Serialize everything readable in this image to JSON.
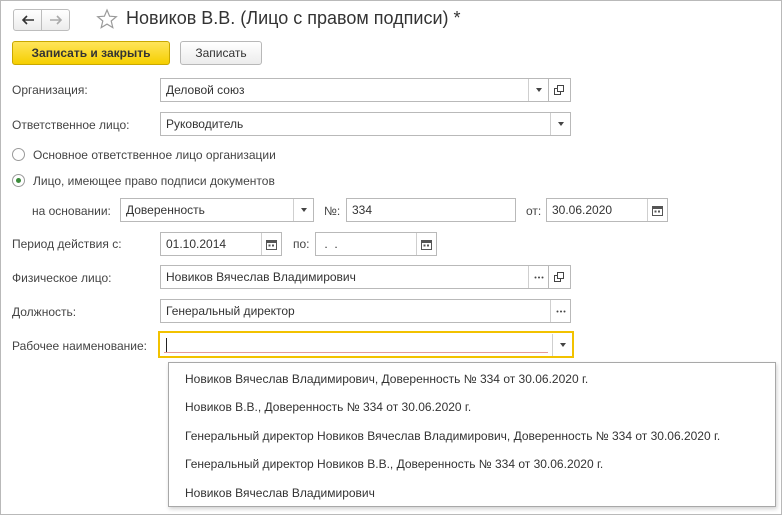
{
  "window": {
    "title": "Новиков В.В. (Лицо с правом подписи) *"
  },
  "toolbar": {
    "save_close_label": "Записать и закрыть",
    "save_label": "Записать"
  },
  "form": {
    "organization": {
      "label": "Организация:",
      "value": "Деловой союз"
    },
    "responsible": {
      "label": "Ответственное лицо:",
      "value": "Руководитель"
    },
    "radio_main": {
      "label": "Основное ответственное лицо организации",
      "selected": false
    },
    "radio_sign": {
      "label": "Лицо, имеющее право подписи документов",
      "selected": true
    },
    "basis": {
      "label": "на основании:",
      "value": "Доверенность",
      "number_label": "№:",
      "number_value": "334",
      "date_label": "от:",
      "date_value": "30.06.2020"
    },
    "period": {
      "label": "Период действия с:",
      "from_value": "01.10.2014",
      "to_label": "по:",
      "to_value": " .  ."
    },
    "person": {
      "label": "Физическое лицо:",
      "value": "Новиков Вячеслав Владимирович"
    },
    "position": {
      "label": "Должность:",
      "value": "Генеральный директор"
    },
    "working_name": {
      "label": "Рабочее наименование:",
      "value": ""
    }
  },
  "dropdown": {
    "items": [
      "Новиков Вячеслав Владимирович, Доверенность № 334 от 30.06.2020 г.",
      "Новиков В.В., Доверенность № 334 от 30.06.2020 г.",
      "Генеральный директор Новиков Вячеслав Владимирович, Доверенность № 334 от 30.06.2020 г.",
      "Генеральный директор Новиков В.В., Доверенность № 334 от 30.06.2020 г.",
      "Новиков Вячеслав Владимирович"
    ]
  },
  "icons": {
    "back": "arrow-left-icon",
    "forward": "arrow-right-icon",
    "favorite": "star-icon",
    "dropdown": "chevron-down-icon",
    "open": "open-window-icon",
    "select": "ellipsis-icon",
    "calendar": "calendar-icon"
  },
  "colors": {
    "primary_button": "#f5cf00",
    "active_border": "#f2c200",
    "radio_selected": "#3b8b3b"
  }
}
